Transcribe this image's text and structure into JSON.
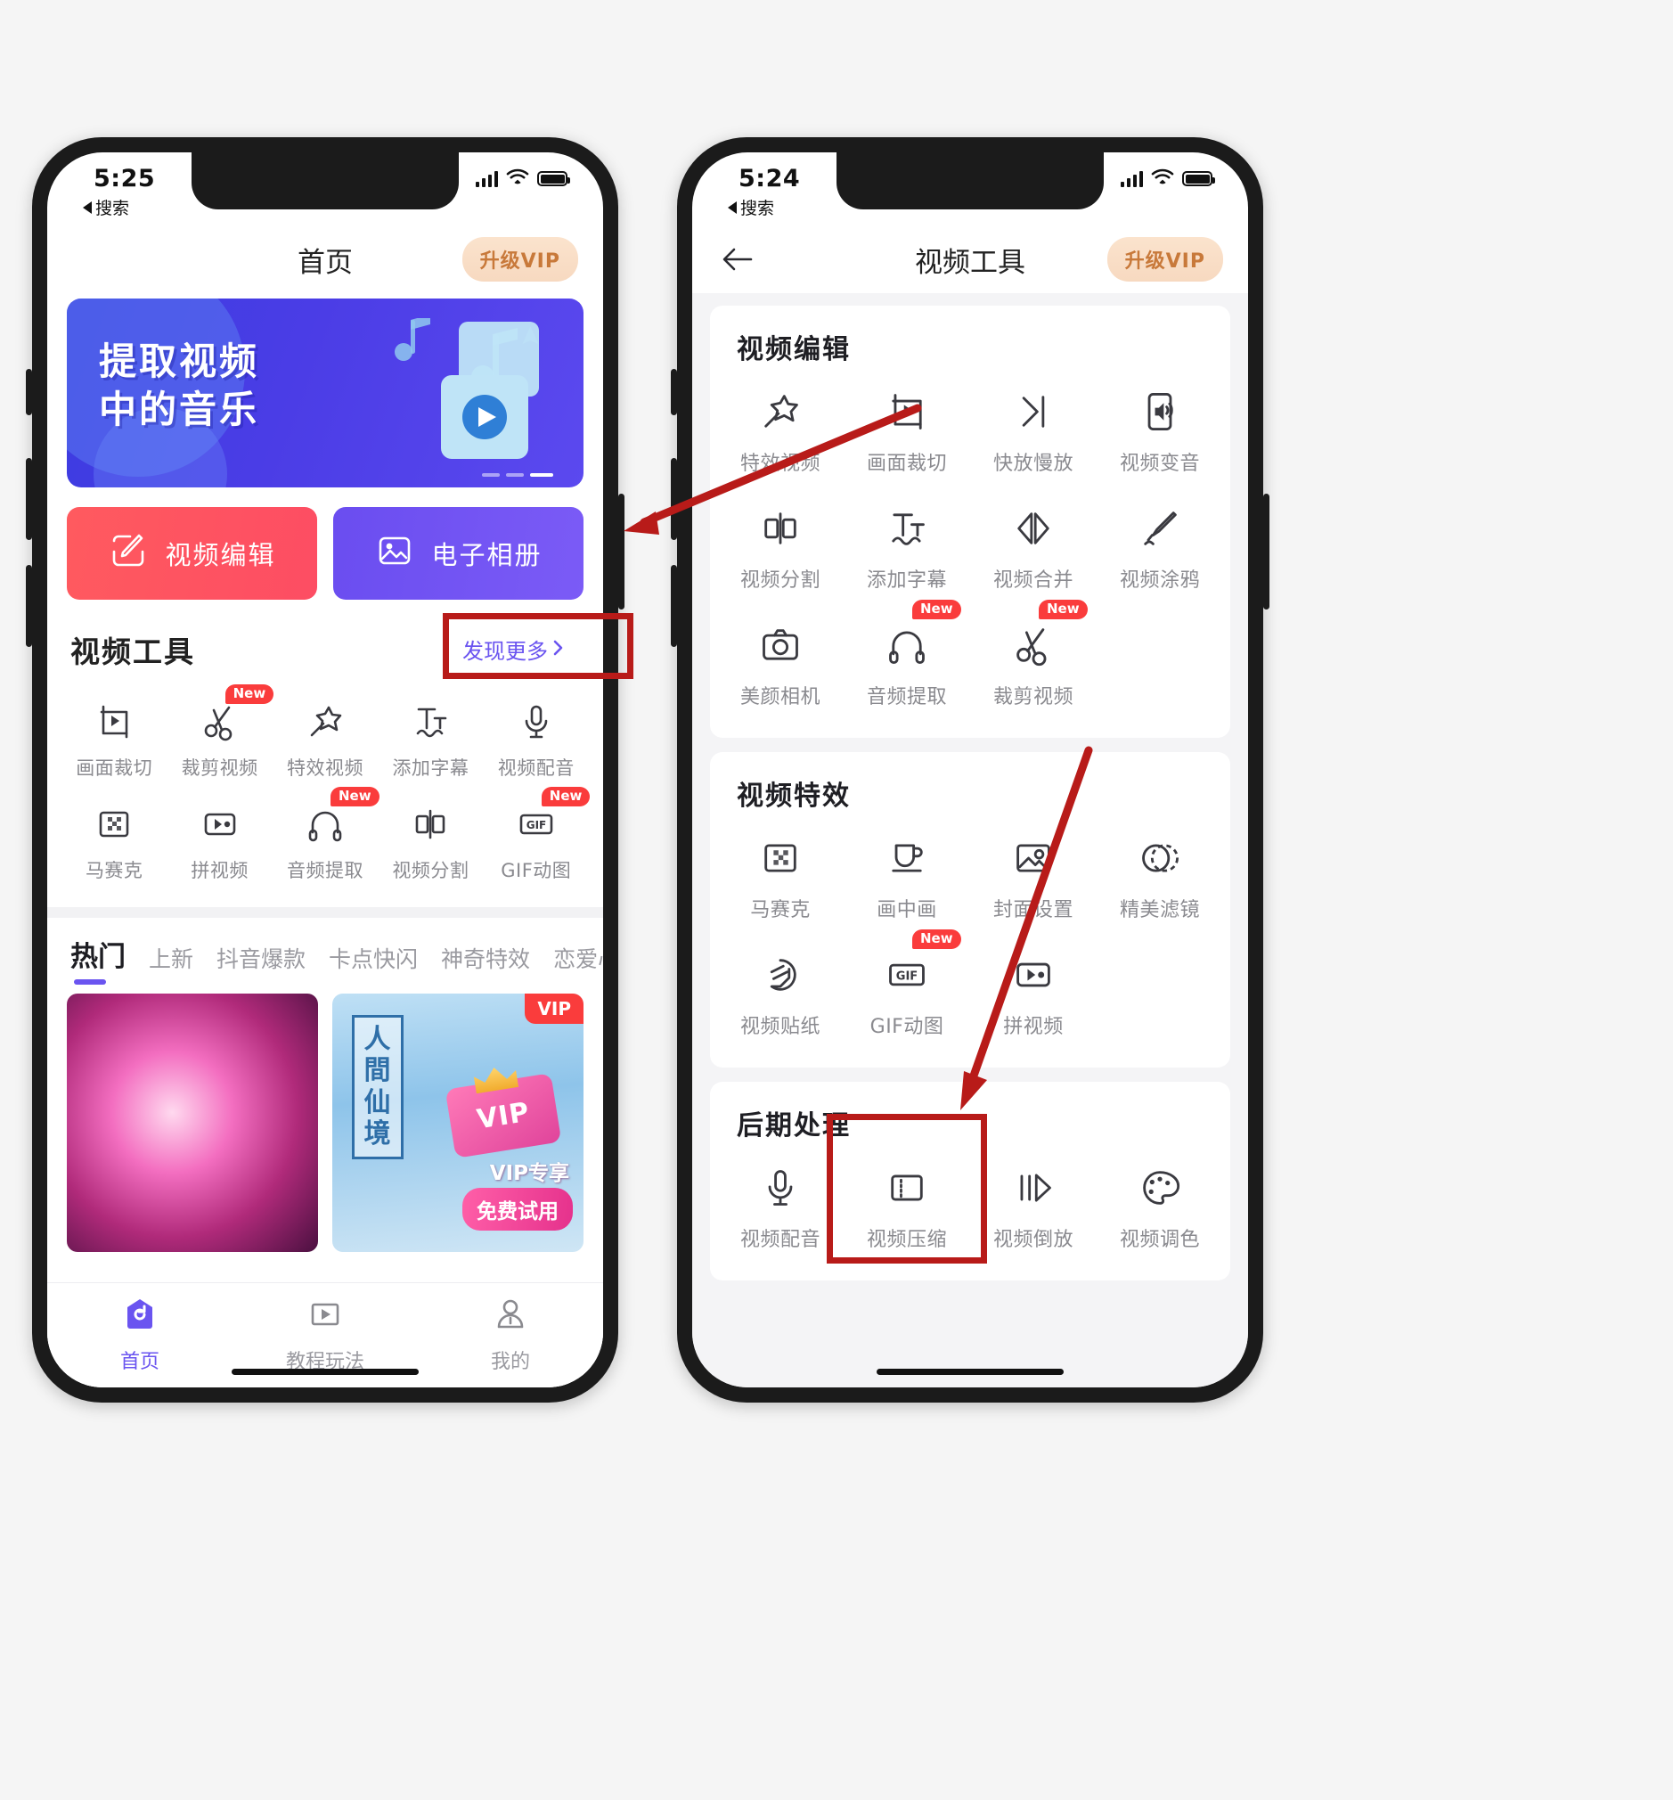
{
  "colors": {
    "accent_purple": "#6a54f0",
    "accent_red": "#fa3c3c",
    "highlight_red": "#b81b19",
    "vip_pill_bg": "#f7d9c0",
    "vip_pill_text": "#c8793a",
    "label_gray": "#8a8a8f"
  },
  "phone_left": {
    "status": {
      "time": "5:25",
      "back_label": "搜索"
    },
    "nav": {
      "title": "首页",
      "vip_button": "升级VIP"
    },
    "banner": {
      "line1": "提取视频",
      "line2": "中的音乐"
    },
    "quick_actions": [
      {
        "label": "视频编辑",
        "icon": "edit-pencil-icon"
      },
      {
        "label": "电子相册",
        "icon": "photo-album-icon"
      }
    ],
    "tools_section": {
      "title": "视频工具",
      "discover_more": "发现更多",
      "items": [
        {
          "label": "画面裁切",
          "icon": "crop-frame-icon",
          "badge": ""
        },
        {
          "label": "裁剪视频",
          "icon": "scissors-icon",
          "badge": "New"
        },
        {
          "label": "特效视频",
          "icon": "magic-wand-icon",
          "badge": ""
        },
        {
          "label": "添加字幕",
          "icon": "text-subtitle-icon",
          "badge": ""
        },
        {
          "label": "视频配音",
          "icon": "microphone-icon",
          "badge": ""
        },
        {
          "label": "马赛克",
          "icon": "mosaic-icon",
          "badge": ""
        },
        {
          "label": "拼视频",
          "icon": "merge-video-icon",
          "badge": ""
        },
        {
          "label": "音频提取",
          "icon": "headphones-icon",
          "badge": "New"
        },
        {
          "label": "视频分割",
          "icon": "split-icon",
          "badge": ""
        },
        {
          "label": "GIF动图",
          "icon": "gif-icon",
          "badge": "New"
        }
      ]
    },
    "hot_tabs": [
      {
        "label": "热门",
        "active": true
      },
      {
        "label": "上新",
        "active": false
      },
      {
        "label": "抖音爆款",
        "active": false
      },
      {
        "label": "卡点快闪",
        "active": false
      },
      {
        "label": "神奇特效",
        "active": false
      },
      {
        "label": "恋爱心情",
        "active": false
      }
    ],
    "cards": [
      {
        "name": "fireworks-card",
        "vip": ""
      },
      {
        "name": "vip-card",
        "vip": "VIP",
        "poster_text": "人間仙境",
        "badge_text": "VIP",
        "promo_line1": "VIP专享",
        "promo_line2": "免费试用"
      }
    ],
    "tabbar": [
      {
        "label": "首页",
        "icon": "home-icon",
        "active": true
      },
      {
        "label": "教程玩法",
        "icon": "tutorial-play-icon",
        "active": false
      },
      {
        "label": "我的",
        "icon": "profile-person-icon",
        "active": false
      }
    ]
  },
  "phone_right": {
    "status": {
      "time": "5:24",
      "back_label": "搜索"
    },
    "nav": {
      "title": "视频工具",
      "vip_button": "升级VIP",
      "back_icon": "back-arrow-icon"
    },
    "sections": [
      {
        "title": "视频编辑",
        "items": [
          {
            "label": "特效视频",
            "icon": "magic-wand-icon",
            "badge": ""
          },
          {
            "label": "画面裁切",
            "icon": "crop-frame-icon",
            "badge": ""
          },
          {
            "label": "快放慢放",
            "icon": "speed-icon",
            "badge": ""
          },
          {
            "label": "视频变音",
            "icon": "voice-change-icon",
            "badge": ""
          },
          {
            "label": "视频分割",
            "icon": "split-icon",
            "badge": ""
          },
          {
            "label": "添加字幕",
            "icon": "text-subtitle-icon",
            "badge": ""
          },
          {
            "label": "视频合并",
            "icon": "merge-arrows-icon",
            "badge": ""
          },
          {
            "label": "视频涂鸦",
            "icon": "brush-icon",
            "badge": ""
          },
          {
            "label": "美颜相机",
            "icon": "camera-icon",
            "badge": ""
          },
          {
            "label": "音频提取",
            "icon": "headphones-icon",
            "badge": "New"
          },
          {
            "label": "裁剪视频",
            "icon": "scissors-icon",
            "badge": "New"
          }
        ]
      },
      {
        "title": "视频特效",
        "items": [
          {
            "label": "马赛克",
            "icon": "mosaic-icon",
            "badge": ""
          },
          {
            "label": "画中画",
            "icon": "cup-pip-icon",
            "badge": ""
          },
          {
            "label": "封面设置",
            "icon": "cover-image-icon",
            "badge": ""
          },
          {
            "label": "精美滤镜",
            "icon": "filter-circle-icon",
            "badge": ""
          },
          {
            "label": "视频贴纸",
            "icon": "sticker-icon",
            "badge": ""
          },
          {
            "label": "GIF动图",
            "icon": "gif-icon",
            "badge": "New"
          },
          {
            "label": "拼视频",
            "icon": "merge-video-icon",
            "badge": ""
          }
        ]
      },
      {
        "title": "后期处理",
        "items": [
          {
            "label": "视频配音",
            "icon": "microphone-icon",
            "badge": ""
          },
          {
            "label": "视频压缩",
            "icon": "compress-icon",
            "badge": ""
          },
          {
            "label": "视频倒放",
            "icon": "reverse-play-icon",
            "badge": ""
          },
          {
            "label": "视频调色",
            "icon": "palette-icon",
            "badge": ""
          }
        ]
      }
    ]
  },
  "annotations": {
    "highlight_boxes": [
      "发现更多",
      "视频压缩"
    ],
    "arrows": [
      "discover-more-to-video-tools",
      "video-effects-to-post-processing"
    ]
  }
}
